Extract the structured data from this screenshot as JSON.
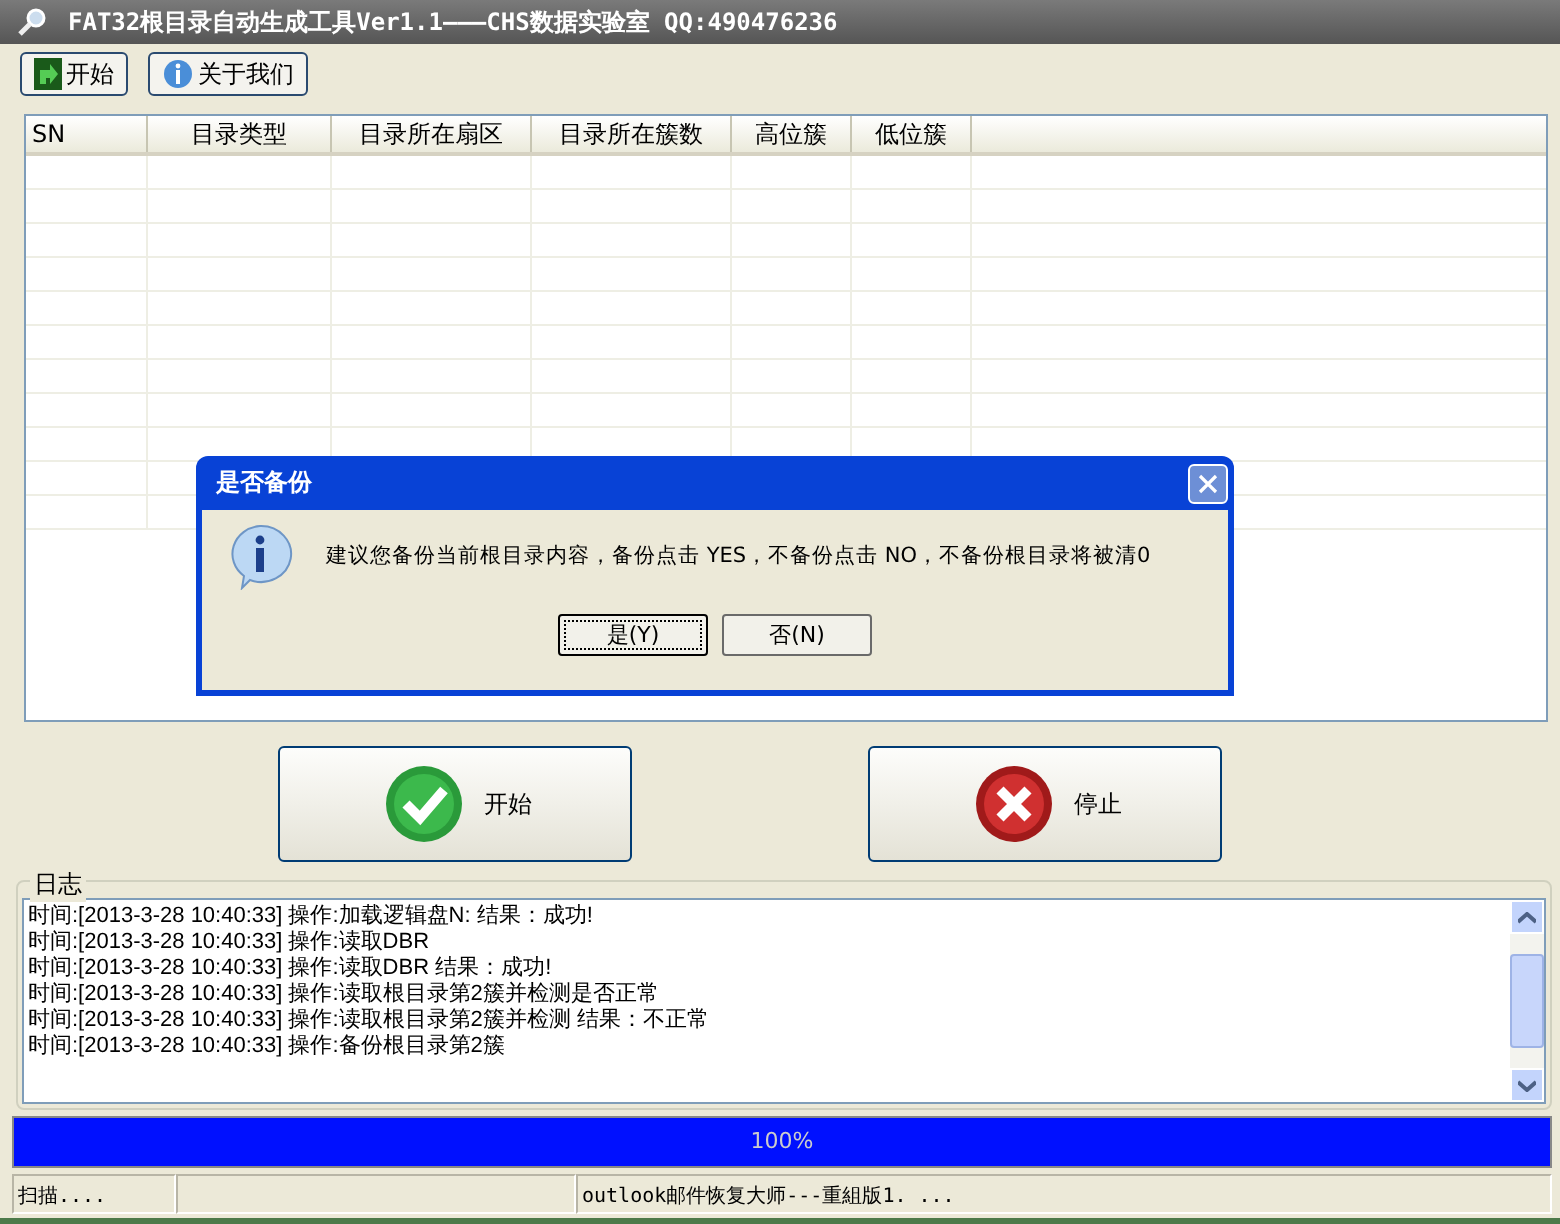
{
  "window": {
    "title": "FAT32根目录自动生成工具Ver1.1———CHS数据实验室 QQ:490476236"
  },
  "toolbar": [
    {
      "label": "开始",
      "kind": "start"
    },
    {
      "label": "关于我们",
      "kind": "about"
    }
  ],
  "table": {
    "columns": [
      "SN",
      "目录类型",
      "目录所在扇区",
      "目录所在簇数",
      "高位簇",
      "低位簇"
    ]
  },
  "dialog": {
    "title": "是否备份",
    "message": "建议您备份当前根目录内容，备份点击 YES，不备份点击 NO，不备份根目录将被清0",
    "buttons": [
      {
        "label": "是(Y)",
        "selected": true
      },
      {
        "label": "否(N)",
        "selected": false
      }
    ]
  },
  "actions": [
    {
      "label": "开始",
      "kind": "start"
    },
    {
      "label": "停止",
      "kind": "stop"
    }
  ],
  "log": {
    "title": "日志",
    "lines": [
      "时间:[2013-3-28 10:40:33] 操作:加载逻辑盘N: 结果：成功!",
      "时间:[2013-3-28 10:40:33] 操作:读取DBR",
      "时间:[2013-3-28 10:40:33] 操作:读取DBR 结果：成功!",
      "时间:[2013-3-28 10:40:33] 操作:读取根目录第2簇并检测是否正常",
      "时间:[2013-3-28 10:40:33] 操作:读取根目录第2簇并检测 结果：不正常",
      "时间:[2013-3-28 10:40:33] 操作:备份根目录第2簇"
    ]
  },
  "progress": {
    "level": 1,
    "reading": "100%"
  },
  "status_bar": {
    "left": "扫描....",
    "right": "outlook邮件恢复大师---重組版1. ..."
  }
}
